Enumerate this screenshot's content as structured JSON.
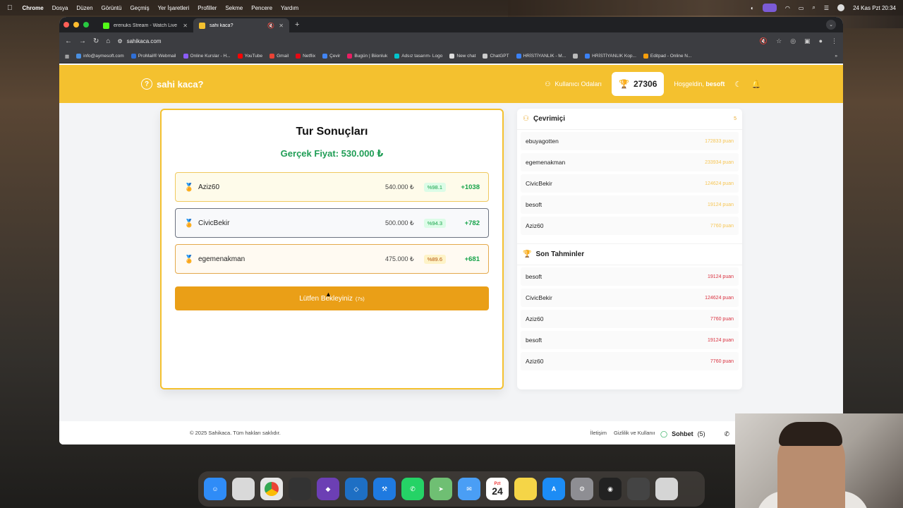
{
  "menubar": {
    "app": "Chrome",
    "items": [
      "Dosya",
      "Düzen",
      "Görüntü",
      "Geçmiş",
      "Yer İşaretleri",
      "Profiller",
      "Sekme",
      "Pencere",
      "Yardım"
    ],
    "clock": "24 Kas Pzt  20:34"
  },
  "browser": {
    "tabs": [
      {
        "title": "erenuks Stream - Watch Live",
        "color": "#53fc18"
      },
      {
        "title": "sahi kaca?",
        "color": "#f4c12f"
      }
    ],
    "url": "sahikaca.com",
    "bookmarks": [
      "info@aymesoft.com",
      "ProMail® Webmail",
      "Online Kurslar - H...",
      "YouTube",
      "Gmail",
      "Netflix",
      "Çevir",
      "Bugün | Biionluk",
      "Adsız tasarım- Logo",
      "New chat",
      "ChatGPT",
      "HRİSTİYANLIK - M...",
      "",
      "HRİSTİYANLIK Kop...",
      "Editpad - Online N..."
    ],
    "more": "»"
  },
  "header": {
    "logo": "sahi kaca?",
    "rooms_label": "Kullanıcı Odaları",
    "score": "27306",
    "welcome_prefix": "Hoşgeldin,",
    "username": "besoft"
  },
  "result": {
    "title": "Tur Sonuçları",
    "real_price": "Gerçek Fiyat: 530.000 ₺",
    "guesses": [
      {
        "name": "Aziz60",
        "price": "540.000 ₺",
        "accuracy": "%98.1",
        "points": "+1038"
      },
      {
        "name": "CivicBekir",
        "price": "500.000 ₺",
        "accuracy": "%94.3",
        "points": "+782"
      },
      {
        "name": "egemenakman",
        "price": "475.000 ₺",
        "accuracy": "%89.6",
        "points": "+681"
      }
    ],
    "wait_label": "Lütfen Bekleyiniz",
    "wait_seconds": "(7s)"
  },
  "online": {
    "title": "Çevrimiçi",
    "count": "5",
    "users": [
      {
        "name": "ebuyagotten",
        "points": "172833 puan"
      },
      {
        "name": "egemenakman",
        "points": "233934 puan"
      },
      {
        "name": "CivicBekir",
        "points": "124624 puan"
      },
      {
        "name": "besoft",
        "points": "19124 puan"
      },
      {
        "name": "Aziz60",
        "points": "7760 puan"
      }
    ]
  },
  "recent": {
    "title": "Son Tahminler",
    "items": [
      {
        "name": "besoft",
        "points": "19124 puan"
      },
      {
        "name": "CivicBekir",
        "points": "124624 puan"
      },
      {
        "name": "Aziz60",
        "points": "7760 puan"
      },
      {
        "name": "besoft",
        "points": "19124 puan"
      },
      {
        "name": "Aziz60",
        "points": "7760 puan"
      }
    ]
  },
  "footer": {
    "copyright": "© 2025 Sahikaca. Tüm hakları saklıdır.",
    "contact": "İletişim",
    "privacy": "Gizlilik ve Kullanım K"
  },
  "chat": {
    "label": "Sohbet",
    "count": "(5)"
  },
  "dock": {
    "calendar_day": "24",
    "calendar_weekday": "Pzt"
  }
}
